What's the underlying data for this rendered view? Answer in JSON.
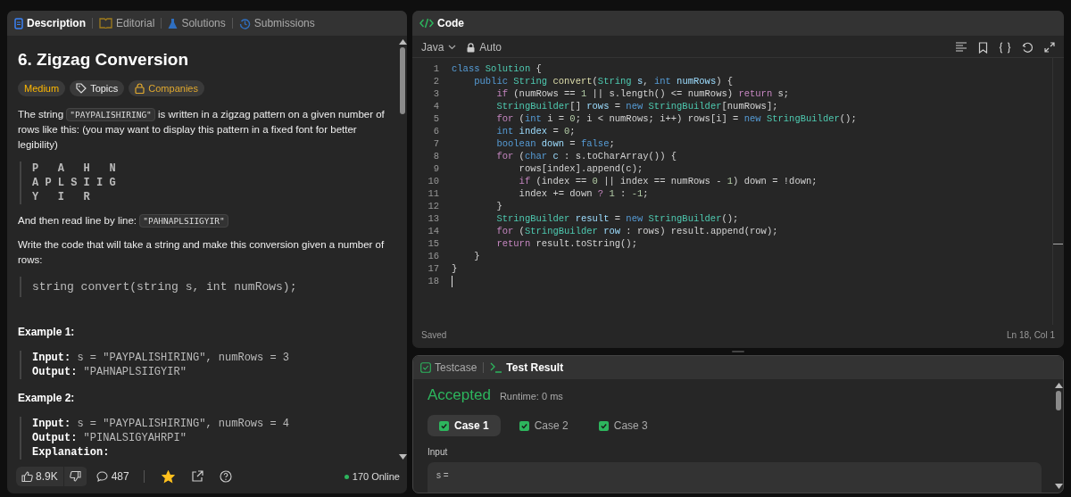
{
  "left_tabs": [
    {
      "label": "Description",
      "selected": true
    },
    {
      "label": "Editorial",
      "selected": false
    },
    {
      "label": "Solutions",
      "selected": false
    },
    {
      "label": "Submissions",
      "selected": false
    }
  ],
  "problem": {
    "title": "6. Zigzag Conversion",
    "tags": [
      {
        "label": "Medium",
        "kind": "difficulty"
      },
      {
        "label": "Topics",
        "kind": "topics"
      },
      {
        "label": "Companies",
        "kind": "companies"
      }
    ],
    "intro": [
      {
        "text": "The string ",
        "code": false
      },
      {
        "text": "\"PAYPALISHIRING\"",
        "code": true
      },
      {
        "text": " is written in a zigzag pattern on a given number of rows like this: (you may want to display this pattern in a fixed font for better legibility)",
        "code": false
      }
    ],
    "pattern": [
      "P   A   H   N",
      "A P L S I I G",
      "Y   I   R"
    ],
    "read": [
      {
        "text": "And then read line by line: ",
        "code": false
      },
      {
        "text": "\"PAHNAPLSIIGYIR\"",
        "code": true
      }
    ],
    "write": "Write the code that will take a string and make this conversion given a number of rows:",
    "signature": "string convert(string s, int numRows);",
    "examples": [
      {
        "title": "Example 1:",
        "lines": [
          {
            "label": "Input:",
            "value": " s = \"PAYPALISHIRING\", numRows = 3"
          },
          {
            "label": "Output:",
            "value": " \"PAHNAPLSIIGYIR\""
          }
        ]
      },
      {
        "title": "Example 2:",
        "lines": [
          {
            "label": "Input:",
            "value": " s = \"PAYPALISHIRING\", numRows = 4"
          },
          {
            "label": "Output:",
            "value": " \"PINALSIGYAHRPI\""
          },
          {
            "label": "Explanation:"
          }
        ]
      }
    ]
  },
  "footer": {
    "likes": "8.9K",
    "comments": "487",
    "starred": true,
    "online": "170 Online"
  },
  "code_panel": {
    "title": "Code",
    "language": "Java",
    "mode": "Auto",
    "status": "Saved",
    "cursor": "Ln 18, Col 1",
    "lines": [
      {
        "number": "1",
        "tokens": [
          {
            "t": "class",
            "kind": "keyword"
          },
          {
            "t": " Solution",
            "kind": "type"
          },
          {
            "t": " {",
            "kind": "plain"
          }
        ]
      },
      {
        "number": "2",
        "tokens": [
          {
            "t": "    public",
            "kind": "keyword"
          },
          {
            "t": " String",
            "kind": "type"
          },
          {
            "t": " convert",
            "kind": "func"
          },
          {
            "t": "(",
            "kind": "plain"
          },
          {
            "t": "String",
            "kind": "type"
          },
          {
            "t": " s",
            "kind": "var"
          },
          {
            "t": ", ",
            "kind": "plain"
          },
          {
            "t": "int",
            "kind": "keyword"
          },
          {
            "t": " numRows",
            "kind": "var"
          },
          {
            "t": ") {",
            "kind": "plain"
          }
        ]
      },
      {
        "number": "3",
        "tokens": [
          {
            "t": "        if",
            "kind": "control"
          },
          {
            "t": " (numRows == ",
            "kind": "plain"
          },
          {
            "t": "1",
            "kind": "num"
          },
          {
            "t": " || s.length() <= numRows) ",
            "kind": "plain"
          },
          {
            "t": "return",
            "kind": "control"
          },
          {
            "t": " s;",
            "kind": "plain"
          }
        ]
      },
      {
        "number": "4",
        "tokens": [
          {
            "t": "        StringBuilder",
            "kind": "type"
          },
          {
            "t": "[] ",
            "kind": "plain"
          },
          {
            "t": "rows",
            "kind": "var"
          },
          {
            "t": " = ",
            "kind": "plain"
          },
          {
            "t": "new",
            "kind": "keyword"
          },
          {
            "t": " StringBuilder",
            "kind": "type"
          },
          {
            "t": "[numRows];",
            "kind": "plain"
          }
        ]
      },
      {
        "number": "5",
        "tokens": [
          {
            "t": "        for",
            "kind": "control"
          },
          {
            "t": " (",
            "kind": "plain"
          },
          {
            "t": "int",
            "kind": "keyword"
          },
          {
            "t": " i = ",
            "kind": "plain"
          },
          {
            "t": "0",
            "kind": "num"
          },
          {
            "t": "; i < numRows; i++) rows[i] = ",
            "kind": "plain"
          },
          {
            "t": "new",
            "kind": "keyword"
          },
          {
            "t": " StringBuilder",
            "kind": "type"
          },
          {
            "t": "();",
            "kind": "plain"
          }
        ]
      },
      {
        "number": "6",
        "tokens": [
          {
            "t": "        int",
            "kind": "keyword"
          },
          {
            "t": " index",
            "kind": "var"
          },
          {
            "t": " = ",
            "kind": "plain"
          },
          {
            "t": "0",
            "kind": "num"
          },
          {
            "t": ";",
            "kind": "plain"
          }
        ]
      },
      {
        "number": "7",
        "tokens": [
          {
            "t": "        boolean",
            "kind": "keyword"
          },
          {
            "t": " down",
            "kind": "var"
          },
          {
            "t": " = ",
            "kind": "plain"
          },
          {
            "t": "false",
            "kind": "keyword"
          },
          {
            "t": ";",
            "kind": "plain"
          }
        ]
      },
      {
        "number": "8",
        "tokens": [
          {
            "t": "        for",
            "kind": "control"
          },
          {
            "t": " (",
            "kind": "plain"
          },
          {
            "t": "char",
            "kind": "keyword"
          },
          {
            "t": " c",
            "kind": "var"
          },
          {
            "t": " : s.toCharArray()) {",
            "kind": "plain"
          }
        ]
      },
      {
        "number": "9",
        "tokens": [
          {
            "t": "            rows[index].append(c);",
            "kind": "plain"
          }
        ]
      },
      {
        "number": "10",
        "tokens": [
          {
            "t": "            if",
            "kind": "control"
          },
          {
            "t": " (index == ",
            "kind": "plain"
          },
          {
            "t": "0",
            "kind": "num"
          },
          {
            "t": " || index == numRows - ",
            "kind": "plain"
          },
          {
            "t": "1",
            "kind": "num"
          },
          {
            "t": ") down = !down;",
            "kind": "plain"
          }
        ]
      },
      {
        "number": "11",
        "tokens": [
          {
            "t": "            index += down ",
            "kind": "plain"
          },
          {
            "t": "?",
            "kind": "control"
          },
          {
            "t": " 1",
            "kind": "num"
          },
          {
            "t": " : ",
            "kind": "plain"
          },
          {
            "t": "-1",
            "kind": "num"
          },
          {
            "t": ";",
            "kind": "plain"
          }
        ]
      },
      {
        "number": "12",
        "tokens": [
          {
            "t": "        }",
            "kind": "plain"
          }
        ]
      },
      {
        "number": "13",
        "tokens": [
          {
            "t": "        StringBuilder",
            "kind": "type"
          },
          {
            "t": " result",
            "kind": "var"
          },
          {
            "t": " = ",
            "kind": "plain"
          },
          {
            "t": "new",
            "kind": "keyword"
          },
          {
            "t": " StringBuilder",
            "kind": "type"
          },
          {
            "t": "();",
            "kind": "plain"
          }
        ]
      },
      {
        "number": "14",
        "tokens": [
          {
            "t": "        for",
            "kind": "control"
          },
          {
            "t": " (",
            "kind": "plain"
          },
          {
            "t": "StringBuilder",
            "kind": "type"
          },
          {
            "t": " row",
            "kind": "var"
          },
          {
            "t": " : rows) result.append(row);",
            "kind": "plain"
          }
        ]
      },
      {
        "number": "15",
        "tokens": [
          {
            "t": "        return",
            "kind": "control"
          },
          {
            "t": " result.toString();",
            "kind": "plain"
          }
        ]
      },
      {
        "number": "16",
        "tokens": [
          {
            "t": "    }",
            "kind": "plain"
          }
        ]
      },
      {
        "number": "17",
        "tokens": [
          {
            "t": "}",
            "kind": "plain"
          }
        ]
      },
      {
        "number": "18"
      }
    ]
  },
  "test_panel": {
    "tabs": [
      {
        "label": "Testcase",
        "selected": false
      },
      {
        "label": "Test Result",
        "selected": true
      }
    ],
    "verdict": "Accepted",
    "runtime": "Runtime: 0 ms",
    "cases": [
      {
        "label": "Case 1",
        "selected": true
      },
      {
        "label": "Case 2",
        "selected": false
      },
      {
        "label": "Case 3",
        "selected": false
      }
    ],
    "input_label": "Input",
    "input_value": "s ="
  }
}
